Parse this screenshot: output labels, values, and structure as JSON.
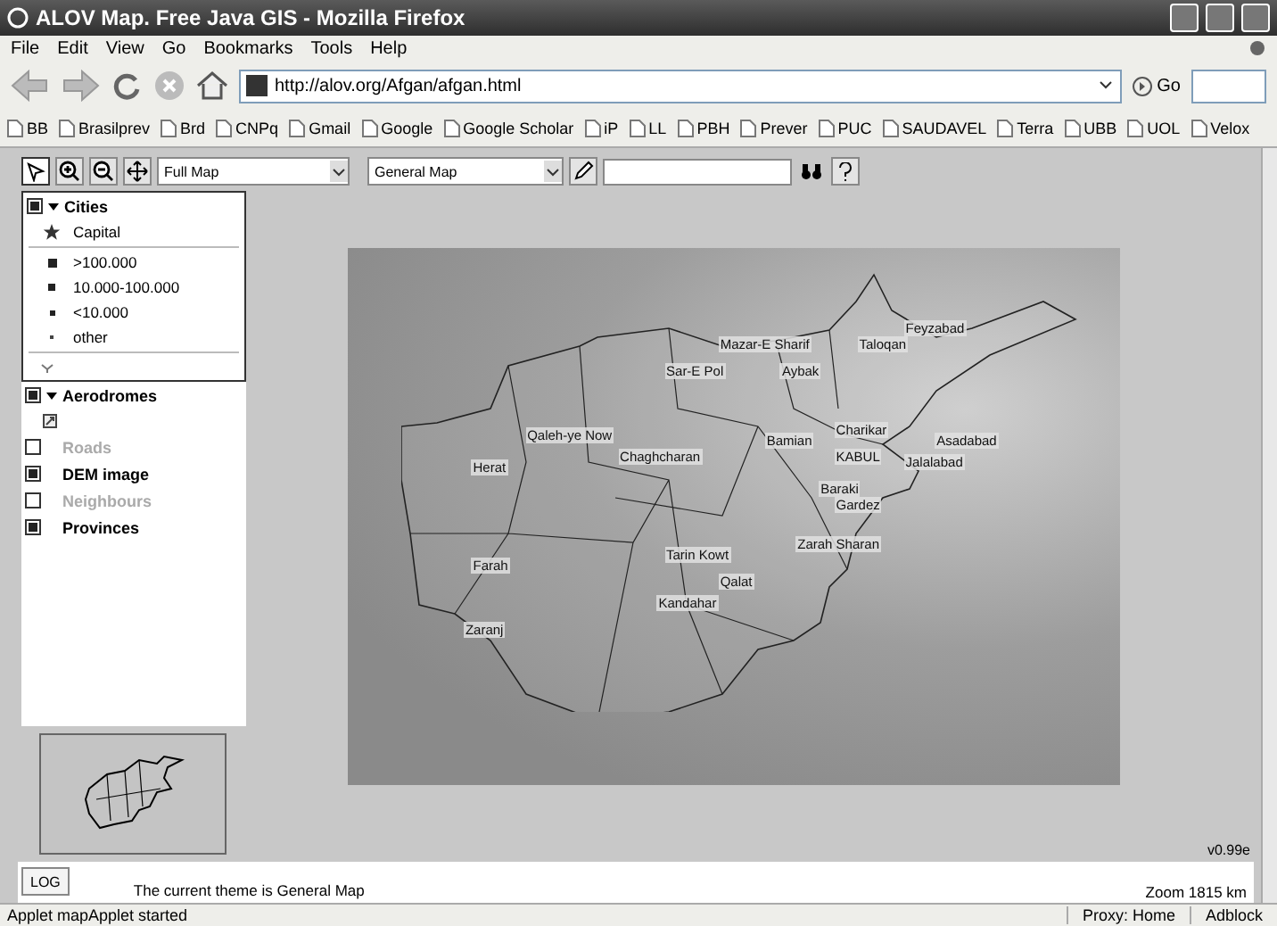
{
  "window": {
    "title": "ALOV Map. Free Java GIS - Mozilla Firefox"
  },
  "menu": [
    "File",
    "Edit",
    "View",
    "Go",
    "Bookmarks",
    "Tools",
    "Help"
  ],
  "address": {
    "value": "http://alov.org/Afgan/afgan.html",
    "go": "Go"
  },
  "bookmarks": [
    "BB",
    "Brasilprev",
    "Brd",
    "CNPq",
    "Gmail",
    "Google",
    "Google Scholar",
    "iP",
    "LL",
    "PBH",
    "Prever",
    "PUC",
    "SAUDAVEL",
    "Terra",
    "UBB",
    "UOL",
    "Velox"
  ],
  "applet": {
    "toolbar": {
      "tools": [
        {
          "kind": "pointer",
          "selected": true
        },
        {
          "kind": "zoom-in",
          "selected": false
        },
        {
          "kind": "zoom-out",
          "selected": false
        },
        {
          "kind": "pan",
          "selected": false
        }
      ],
      "extent": "Full Map",
      "theme": "General Map"
    },
    "layers": [
      {
        "name": "Cities",
        "kind": "group",
        "checked": true,
        "expanded": true,
        "legend": [
          {
            "kind": "star",
            "label": "Capital"
          },
          {
            "kind": "large",
            "label": ">100.000"
          },
          {
            "kind": "medium",
            "label": "10.000-100.000"
          },
          {
            "kind": "small",
            "label": "<10.000"
          },
          {
            "kind": "dot",
            "label": "other"
          }
        ]
      },
      {
        "name": "Aerodromes",
        "kind": "group",
        "checked": true,
        "expanded": true,
        "legend": [
          {
            "kind": "airport"
          }
        ]
      },
      {
        "name": "Roads",
        "kind": "layer",
        "checked": false
      },
      {
        "name": "DEM image",
        "kind": "layer",
        "checked": true
      },
      {
        "name": "Neighbours",
        "kind": "layer",
        "checked": false
      },
      {
        "name": "Provinces",
        "kind": "layer",
        "checked": true
      }
    ],
    "map_labels": [
      "Feyzabad",
      "Mazar-E Sharif",
      "Taloqan",
      "Sar-E Pol",
      "Aybak",
      "Qaleh-ye Now",
      "Charikar",
      "Bamian",
      "Asadabad",
      "Herat",
      "Chaghcharan",
      "KABUL",
      "Jalalabad",
      "Baraki",
      "Gardez",
      "Zarah Sharan",
      "Tarin Kowt",
      "Farah",
      "Qalat",
      "Kandahar",
      "Zaranj"
    ],
    "version": "v0.99e",
    "log_button": "LOG",
    "message": "The current theme is General Map",
    "zoom": "Zoom  1815 km"
  },
  "status_bar": {
    "text": "Applet mapApplet started",
    "proxy": "Proxy: Home",
    "addon": "Adblock"
  }
}
